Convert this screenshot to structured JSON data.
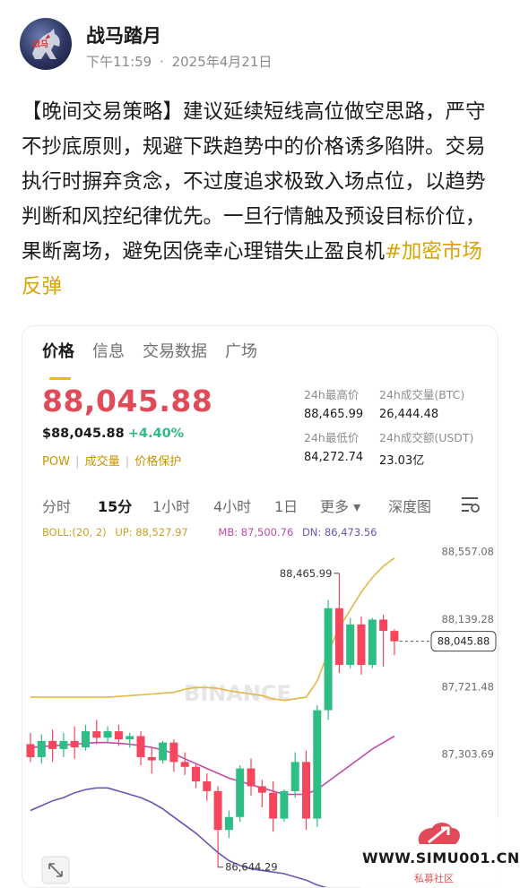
{
  "post": {
    "author": "战马踏月",
    "time": "下午11:59",
    "dot": "·",
    "date": "2025年4月21日",
    "text": "【晚间交易策略】建议延续短线高位做空思路，严守不抄底原则，规避下跌趋势中的价格诱多陷阱。交易执行时摒弃贪念，不过度追求极致入场点位，以趋势判断和风控纪律优先。一旦行情触及预设目标价位，果断离场，避免因侥幸心理错失止盈良机",
    "hashtag": "#加密市场反弹",
    "avatar_text": "战马"
  },
  "card": {
    "tabs": [
      "价格",
      "信息",
      "交易数据",
      "广场"
    ],
    "active_tab": 0,
    "price": "88,045.88",
    "price_usd": "$88,045.88",
    "change": "+4.40%",
    "badges": [
      "POW",
      "|",
      "成交量",
      "|",
      "价格保护"
    ],
    "stats": {
      "high_label": "24h最高价",
      "high_value": "88,465.99",
      "vol_btc_label": "24h成交量(BTC)",
      "vol_btc_value": "26,444.48",
      "low_label": "24h最低价",
      "low_value": "84,272.74",
      "vol_usdt_label": "24h成交额(USDT)",
      "vol_usdt_value": "23.03亿"
    },
    "timeframes": [
      "分时",
      "15分",
      "1小时",
      "4小时",
      "1日",
      "更多 ▾",
      "深度图"
    ],
    "active_timeframe": 1,
    "boll": {
      "label": "BOLL:(20, 2)",
      "up": "UP: 88,527.97",
      "mb": "MB: 87,500.76",
      "dn": "DN: 86,473.56"
    },
    "watermark": "BINANCE"
  },
  "chart_data": {
    "type": "candlestick",
    "y_ticks": [
      "88,557.08",
      "88,139.28",
      "87,721.48",
      "87,303.69"
    ],
    "y_tick_values": [
      88557.08,
      88139.28,
      87721.48,
      87303.69
    ],
    "ylim": [
      86560,
      88620
    ],
    "high_marker": "88,465.99",
    "low_marker": "86,644.29",
    "current_price": "88,045.88",
    "colors": {
      "up": "#2ebd85",
      "down": "#f6465d",
      "upper_band": "#e2b84a",
      "middle_band": "#c04aa9",
      "lower_band": "#6a55b5"
    },
    "candles": [
      {
        "o": 87410,
        "h": 87480,
        "c": 87330,
        "l": 87300
      },
      {
        "o": 87330,
        "h": 87470,
        "c": 87430,
        "l": 87290
      },
      {
        "o": 87430,
        "h": 87500,
        "c": 87380,
        "l": 87300
      },
      {
        "o": 87380,
        "h": 87480,
        "c": 87430,
        "l": 87330
      },
      {
        "o": 87430,
        "h": 87520,
        "c": 87390,
        "l": 87320
      },
      {
        "o": 87390,
        "h": 87530,
        "c": 87490,
        "l": 87370
      },
      {
        "o": 87490,
        "h": 87560,
        "c": 87450,
        "l": 87410
      },
      {
        "o": 87450,
        "h": 87520,
        "c": 87490,
        "l": 87420
      },
      {
        "o": 87490,
        "h": 87530,
        "c": 87440,
        "l": 87400
      },
      {
        "o": 87440,
        "h": 87480,
        "c": 87460,
        "l": 87390
      },
      {
        "o": 87460,
        "h": 87490,
        "c": 87330,
        "l": 87280
      },
      {
        "o": 87330,
        "h": 87390,
        "c": 87310,
        "l": 87230
      },
      {
        "o": 87310,
        "h": 87430,
        "c": 87420,
        "l": 87290
      },
      {
        "o": 87420,
        "h": 87440,
        "c": 87300,
        "l": 87240
      },
      {
        "o": 87300,
        "h": 87360,
        "c": 87270,
        "l": 87220
      },
      {
        "o": 87270,
        "h": 87290,
        "c": 87180,
        "l": 87140
      },
      {
        "o": 87180,
        "h": 87230,
        "c": 87120,
        "l": 87060
      },
      {
        "o": 87120,
        "h": 87150,
        "c": 86880,
        "l": 86650
      },
      {
        "o": 86880,
        "h": 87000,
        "c": 86960,
        "l": 86830
      },
      {
        "o": 86960,
        "h": 87280,
        "c": 87260,
        "l": 86930
      },
      {
        "o": 87260,
        "h": 87320,
        "c": 87150,
        "l": 87090
      },
      {
        "o": 87150,
        "h": 87190,
        "c": 87110,
        "l": 87020
      },
      {
        "o": 87110,
        "h": 87180,
        "c": 86950,
        "l": 86870
      },
      {
        "o": 86950,
        "h": 87130,
        "c": 87120,
        "l": 86930
      },
      {
        "o": 87120,
        "h": 87360,
        "c": 87300,
        "l": 87080
      },
      {
        "o": 87300,
        "h": 87370,
        "c": 86950,
        "l": 86880
      },
      {
        "o": 86950,
        "h": 87650,
        "c": 87620,
        "l": 86900
      },
      {
        "o": 87620,
        "h": 88300,
        "c": 88250,
        "l": 87560
      },
      {
        "o": 88250,
        "h": 88465.99,
        "c": 87900,
        "l": 87850
      },
      {
        "o": 87900,
        "h": 88190,
        "c": 88150,
        "l": 87880
      },
      {
        "o": 88150,
        "h": 88200,
        "c": 87900,
        "l": 87840
      },
      {
        "o": 87900,
        "h": 88190,
        "c": 88180,
        "l": 87880
      },
      {
        "o": 88180,
        "h": 88210,
        "c": 88110,
        "l": 87890
      },
      {
        "o": 88110,
        "h": 88120,
        "c": 88045.88,
        "l": 87960
      }
    ],
    "upper_band": [
      87700,
      87700,
      87700,
      87700,
      87700,
      87700,
      87700,
      87700,
      87705,
      87710,
      87715,
      87720,
      87725,
      87730,
      87750,
      87760,
      87760,
      87755,
      87740,
      87730,
      87720,
      87710,
      87690,
      87680,
      87690,
      87700,
      87800,
      87980,
      88130,
      88240,
      88350,
      88440,
      88510,
      88560
    ],
    "middle_band": [
      87390,
      87395,
      87400,
      87405,
      87410,
      87415,
      87420,
      87420,
      87415,
      87410,
      87400,
      87390,
      87375,
      87350,
      87320,
      87290,
      87260,
      87230,
      87200,
      87180,
      87160,
      87140,
      87120,
      87100,
      87100,
      87100,
      87130,
      87180,
      87230,
      87280,
      87330,
      87380,
      87420,
      87460
    ],
    "lower_band": [
      87000,
      87030,
      87060,
      87080,
      87110,
      87130,
      87140,
      87140,
      87120,
      87100,
      87080,
      87050,
      87010,
      86960,
      86910,
      86860,
      86800,
      86740,
      86690,
      86660,
      86640,
      86630,
      86620,
      86610,
      86590,
      86570,
      86540,
      86520,
      86500,
      86490,
      86480,
      86470,
      86460,
      86455
    ]
  },
  "footer": {
    "site": "WWW.SIMU001.CN",
    "site_sub": "私募社区"
  }
}
